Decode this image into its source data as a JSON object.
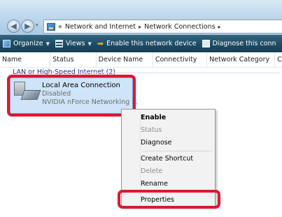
{
  "address_bar": {
    "overflow": "«",
    "crumbs": [
      "Network and Internet",
      "Network Connections"
    ],
    "separator": "▸"
  },
  "toolbar": {
    "organize": "Organize",
    "views": "Views",
    "enable_device": "Enable this network device",
    "diagnose": "Diagnose this conn"
  },
  "columns": [
    "Name",
    "Status",
    "Device Name",
    "Connectivity",
    "Network Category",
    "C"
  ],
  "group_label": "LAN or High-Speed Internet (2)",
  "connection": {
    "name": "Local Area Connection",
    "status": "Disabled",
    "device": "NVIDIA nForce Networking ..."
  },
  "context_menu": {
    "items": [
      {
        "label": "Enable",
        "state": "default"
      },
      {
        "label": "Status",
        "state": "disabled"
      },
      {
        "label": "Diagnose",
        "state": "normal"
      },
      {
        "label": "Create Shortcut",
        "state": "normal"
      },
      {
        "label": "Delete",
        "state": "disabled"
      },
      {
        "label": "Rename",
        "state": "normal"
      },
      {
        "label": "Properties",
        "state": "normal"
      }
    ]
  },
  "colors": {
    "highlight_red": "#e0172f",
    "toolbar_bg": "#1f4d66",
    "selection_bg": "#cfe4f8",
    "group_text": "#1e3287"
  },
  "icons": [
    "back-arrow-icon",
    "forward-arrow-icon",
    "network-folder-icon",
    "organize-icon",
    "views-icon",
    "enable-arrow-icon",
    "diagnose-icon",
    "network-adapter-icon"
  ]
}
